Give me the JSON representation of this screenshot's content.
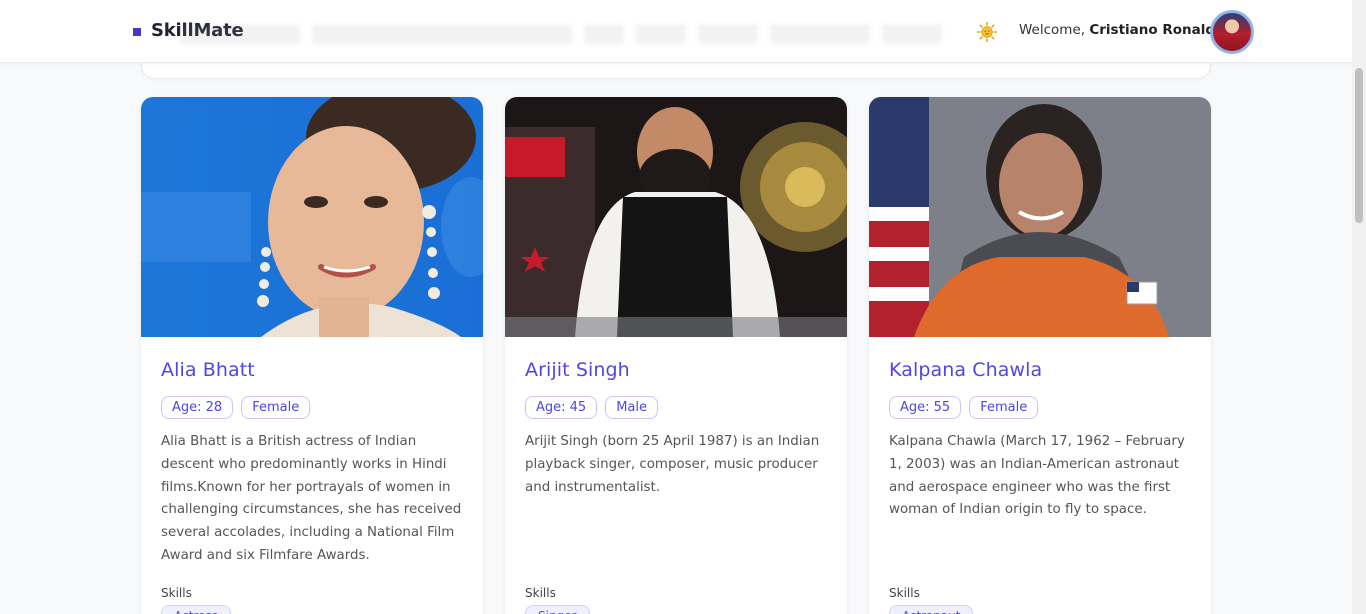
{
  "app": {
    "brand": "SkillMate",
    "theme_icon": "sun-icon",
    "welcome_prefix": "Welcome,",
    "user_name": "Cristiano Ronaldo"
  },
  "colors": {
    "accent": "#4f46e5",
    "brand_mark": "#4338ca"
  },
  "skills_label": "Skills",
  "cards": [
    {
      "name": "Alia Bhatt",
      "age": "Age: 28",
      "gender": "Female",
      "description": "Alia Bhatt is a British actress of Indian descent who predominantly works in Hindi films.Known for her portrayals of women in challenging circumstances, she has received several accolades, including a National Film Award and six Filmfare Awards.",
      "skill": "Actress"
    },
    {
      "name": "Arijit Singh",
      "age": "Age: 45",
      "gender": "Male",
      "description": "Arijit Singh (born 25 April 1987) is an Indian playback singer, composer, music producer and instrumentalist.",
      "skill": "Singer"
    },
    {
      "name": "Kalpana Chawla",
      "age": "Age: 55",
      "gender": "Female",
      "description": "Kalpana Chawla (March 17, 1962 – February 1, 2003) was an Indian-American astronaut and aerospace engineer who was the first woman of Indian origin to fly to space.",
      "skill": "Astronaut"
    }
  ]
}
